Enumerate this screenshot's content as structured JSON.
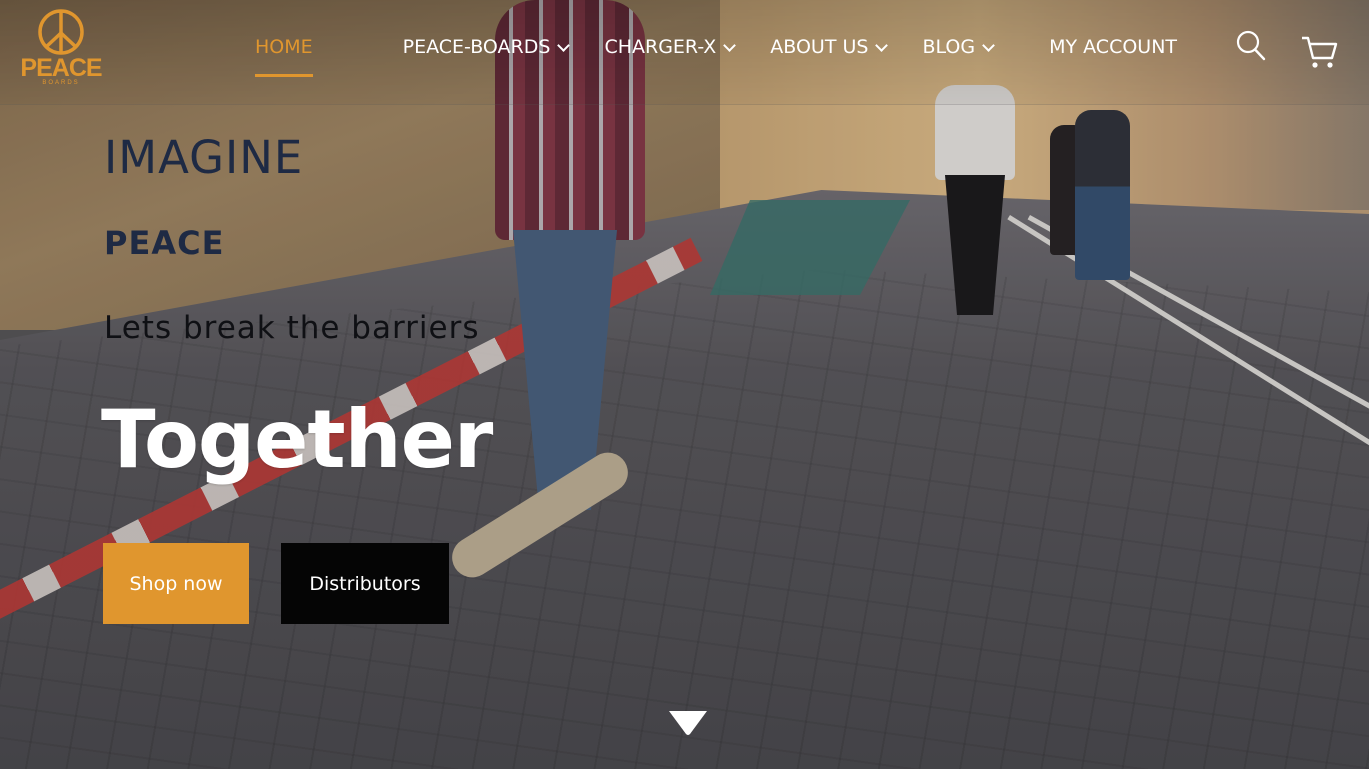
{
  "brand": {
    "name": "PEACE",
    "subtitle": "BOARDS",
    "accent_color": "#e0962e"
  },
  "nav": {
    "items": [
      {
        "label": "HOME",
        "active": true,
        "has_dropdown": false
      },
      {
        "label": "PEACE-BOARDS",
        "active": false,
        "has_dropdown": true
      },
      {
        "label": "CHARGER-X",
        "active": false,
        "has_dropdown": true
      },
      {
        "label": "ABOUT US",
        "active": false,
        "has_dropdown": true
      },
      {
        "label": "BLOG",
        "active": false,
        "has_dropdown": true
      },
      {
        "label": "MY ACCOUNT",
        "active": false,
        "has_dropdown": false
      }
    ],
    "icons": [
      "search-icon",
      "cart-icon"
    ]
  },
  "hero": {
    "line1": "IMAGINE",
    "line2": "PEACE",
    "tagline": "Lets break the barriers",
    "headline": "Together",
    "primary_button": "Shop now",
    "secondary_button": "Distributors",
    "scroll_icon": "chevron-down-icon",
    "colors": {
      "primary_button": "#e0962e",
      "secondary_button": "#050505",
      "heading_text": "#1e2a44"
    }
  }
}
